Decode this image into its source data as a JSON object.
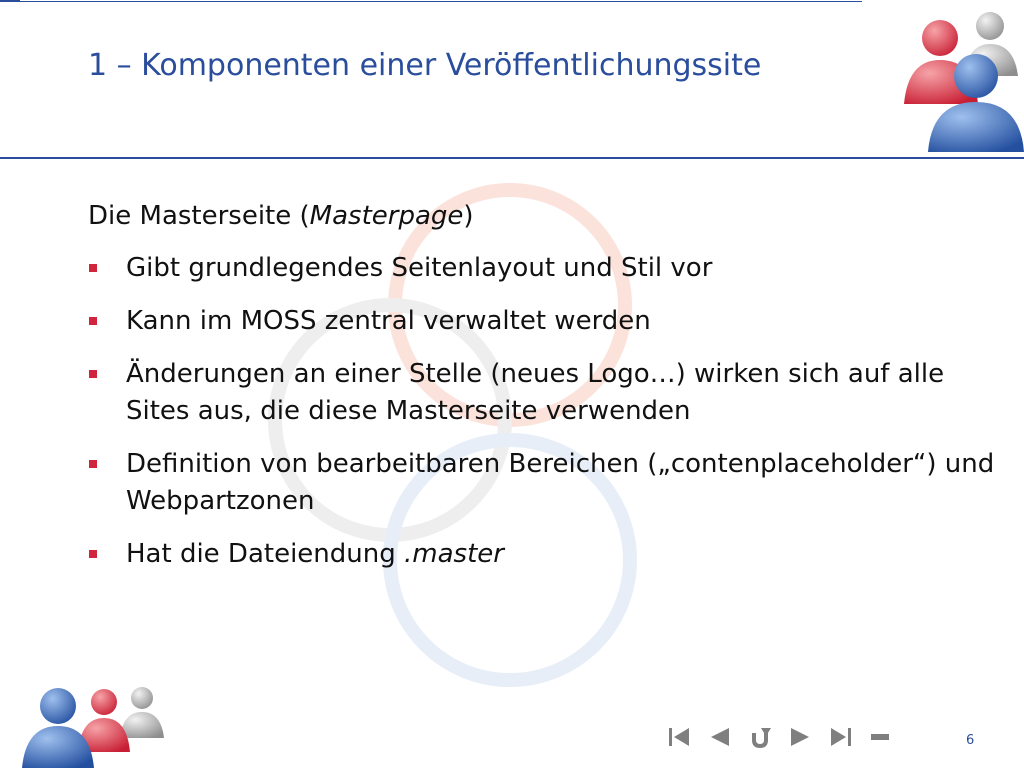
{
  "slide": {
    "title": "1 – Komponenten einer Veröffentlichungssite",
    "heading": {
      "prefix": "Die Masterseite (",
      "emph": "Masterpage",
      "suffix": ")"
    },
    "bullets": [
      {
        "text": "Gibt grundlegendes Seitenlayout und Stil vor"
      },
      {
        "text": "Kann im MOSS zentral verwaltet werden"
      },
      {
        "text": "Änderungen an einer Stelle (neues Logo…) wirken sich auf alle Sites aus, die diese Masterseite verwenden"
      },
      {
        "text": "Definition von bearbeitbaren Bereichen („contenplaceholder“) und Webpartzonen"
      },
      {
        "text": "Hat die Dateiendung ",
        "emph": ".master"
      }
    ],
    "page_number": "6"
  },
  "navigation": {
    "buttons": [
      "first-slide",
      "previous-slide",
      "return",
      "next-slide",
      "last-slide",
      "end-show"
    ]
  },
  "colors": {
    "title": "#2a4d9c",
    "rule": "#2a4d9c",
    "bullet_marker": "#d0253c",
    "body_text": "#111111",
    "nav_icon": "#7f7f7f",
    "person_blue": "#2e5fb0",
    "person_red": "#d0253c",
    "person_gray": "#9a9a9a"
  }
}
